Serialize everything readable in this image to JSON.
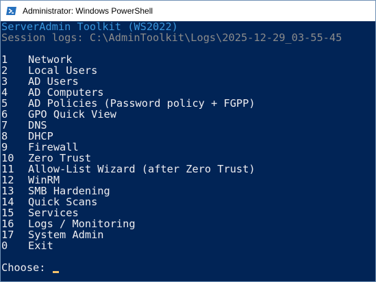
{
  "window": {
    "title": "Administrator: Windows PowerShell",
    "colors": {
      "console_background": "#012456",
      "console_text": "#eeedf0",
      "header_text": "#3a96dd",
      "session_text": "#8b8b8b",
      "cursor": "#f5c36b"
    }
  },
  "console": {
    "header": "ServerAdmin Toolkit (WS2022)",
    "session_logs": "Session logs: C:\\AdminToolkit\\Logs\\2025-12-29_03-55-45",
    "menu": [
      {
        "num": "1",
        "label": "Network"
      },
      {
        "num": "2",
        "label": "Local Users"
      },
      {
        "num": "3",
        "label": "AD Users"
      },
      {
        "num": "4",
        "label": "AD Computers"
      },
      {
        "num": "5",
        "label": "AD Policies (Password policy + FGPP)"
      },
      {
        "num": "6",
        "label": "GPO Quick View"
      },
      {
        "num": "7",
        "label": "DNS"
      },
      {
        "num": "8",
        "label": "DHCP"
      },
      {
        "num": "9",
        "label": "Firewall"
      },
      {
        "num": "10",
        "label": "Zero Trust"
      },
      {
        "num": "11",
        "label": "Allow-List Wizard (after Zero Trust)"
      },
      {
        "num": "12",
        "label": "WinRM"
      },
      {
        "num": "13",
        "label": "SMB Hardening"
      },
      {
        "num": "14",
        "label": "Quick Scans"
      },
      {
        "num": "15",
        "label": "Services"
      },
      {
        "num": "16",
        "label": "Logs / Monitoring"
      },
      {
        "num": "17",
        "label": "System Admin"
      },
      {
        "num": "0",
        "label": "Exit"
      }
    ],
    "prompt": "Choose: "
  }
}
